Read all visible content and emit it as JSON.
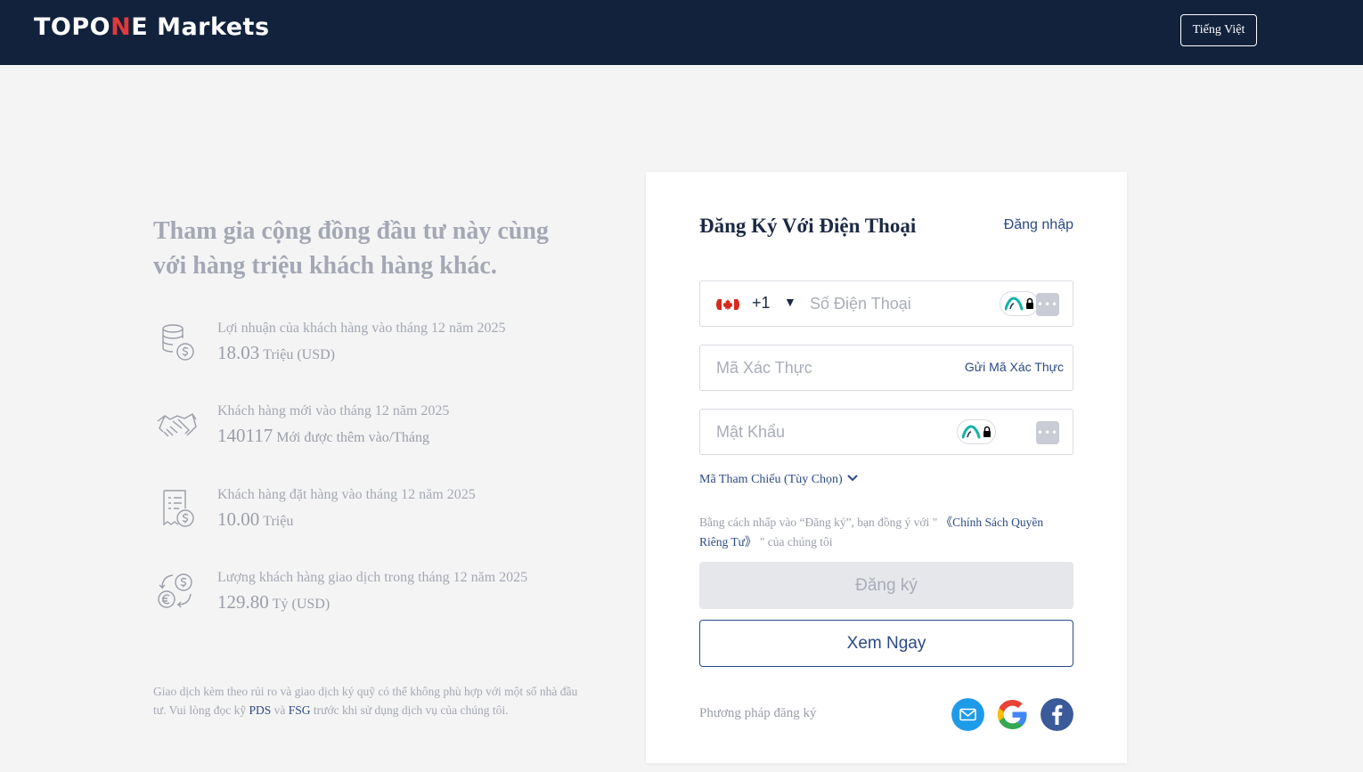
{
  "header": {
    "logo_text_a": "TOPO",
    "logo_text_b": "N",
    "logo_text_c": "E",
    "logo_text_d": " Markets",
    "language_button": "Tiếng Việt"
  },
  "intro": {
    "headline": "Tham gia cộng đồng đầu tư này cùng với hàng triệu khách hàng khác."
  },
  "stats": [
    {
      "icon": "coins-dollar-icon",
      "label": "Lợi nhuận của khách hàng vào tháng 12 năm 2025",
      "value": "18.03",
      "unit": "Triệu (USD)"
    },
    {
      "icon": "handshake-icon",
      "label": "Khách hàng mới vào tháng 12 năm 2025",
      "value": "140117",
      "unit": "Mới được thêm vào/Tháng"
    },
    {
      "icon": "receipt-dollar-icon",
      "label": "Khách hàng đặt hàng vào tháng 12 năm 2025",
      "value": "10.00",
      "unit": "Triệu"
    },
    {
      "icon": "currency-exchange-icon",
      "label": "Lượng khách hàng giao dịch trong tháng 12 năm 2025",
      "value": "129.80",
      "unit": "Tỷ (USD)"
    }
  ],
  "disclaimer": {
    "text_1": "Giao dịch kèm theo rủi ro và giao dịch ký quỹ có thể không phù hợp với một số nhà đầu tư. Vui lòng đọc kỹ ",
    "link_pds": "PDS",
    "text_2": " và ",
    "link_fsg": "FSG",
    "text_3": " trước khi sử dụng dịch vụ của chúng tôi."
  },
  "form": {
    "title": "Đăng Ký Với Điện Thoại",
    "login_link": "Đăng nhập",
    "country_code": "+1",
    "caret": "▼",
    "phone_placeholder": "Số Điện Thoại",
    "code_placeholder": "Mã Xác Thực",
    "send_code": "Gửi Mã Xác Thực",
    "password_placeholder": "Mật Khẩu",
    "password_manager_box": "•••",
    "referral": "Mã Tham Chiếu (Tùy Chọn)",
    "terms_1": "Bằng cách nhấp vào “Đăng ký”, bạn đồng ý với \" ",
    "terms_link": "《Chính Sách Quyền Riêng Tư》",
    "terms_2": " \" của chúng tôi",
    "register_button": "Đăng ký",
    "view_button": "Xem Ngay",
    "methods_label": "Phương pháp đăng ký"
  },
  "colors": {
    "header_bg": "#12223d",
    "accent": "#2c4a86",
    "email_blue": "#1e9be8",
    "facebook_blue": "#3b5a9a"
  }
}
